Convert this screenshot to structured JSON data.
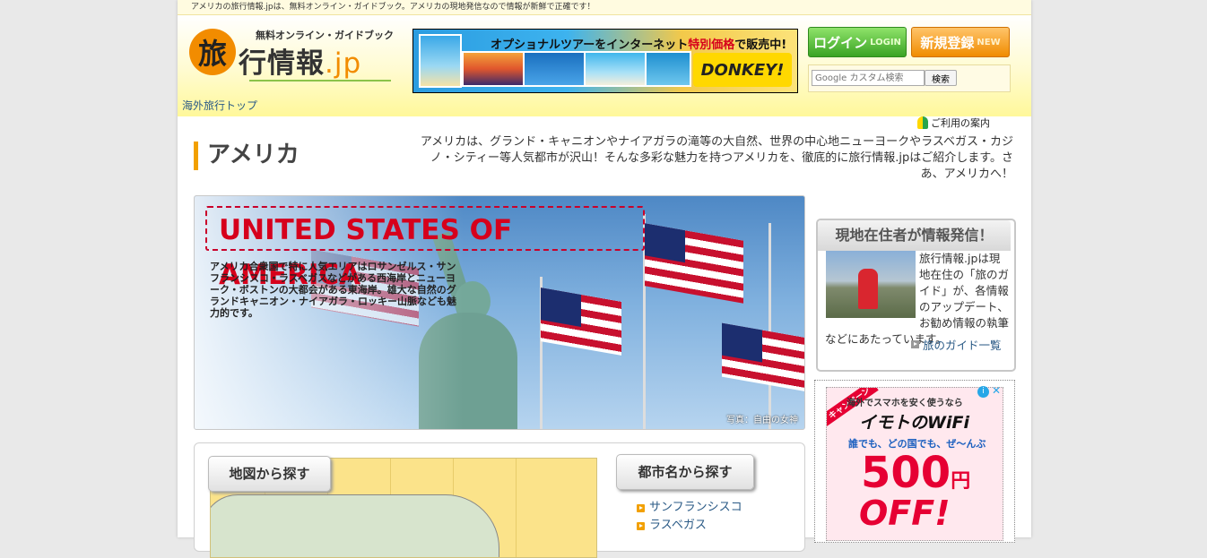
{
  "topbar": {
    "text": "アメリカの旅行情報.jpは、無料オンライン・ガイドブック。アメリカの現地発信なので情報が新鮮で正確です！"
  },
  "header": {
    "logo_small": "無料オンライン・ガイドブック",
    "logo_kanji": "旅",
    "logo_main": "行情報",
    "logo_tld": ".jp",
    "toplink": "海外旅行トップ",
    "banner": {
      "text_pre": "オプショナルツアーをインターネット",
      "text_red": "特別価格",
      "text_post": "で販売中!",
      "brand": "DONKEY!"
    },
    "login_label": "ログイン",
    "login_sub": "LOGIN",
    "register_label": "新規登録",
    "register_sub": "NEW",
    "search_placeholder": "Google カスタム検索",
    "search_button": "検索",
    "guide_link": "ご利用の案内"
  },
  "main": {
    "title": "アメリカ",
    "intro": "アメリカは、グランド・キャニオンやナイアガラの滝等の大自然、世界の中心地ニューヨークやラスベガス・カジノ・シティー等人気都市が沢山！そんな多彩な魅力を持つアメリカを、徹底的に旅行情報.jpはご紹介します。さあ、アメリカへ！",
    "hero": {
      "title": "UNITED STATES OF AMERICA",
      "desc": "アメリカ合衆国で特に人気エリアはロサンゼルス・サンフランシスコ・ラスベガスなどがある西海岸とニューヨーク・ボストンの大都会がある東海岸。雄大な自然のグランドキャニオン・ナイアガラ・ロッキー山脈なども魅力的です。",
      "caption": "写真：自由の女神"
    },
    "map_tab": "地図から探す",
    "city_tab": "都市名から探す",
    "cities": [
      "サンフランシスコ",
      "ラスベガス"
    ]
  },
  "sidebar": {
    "resident_title": "現地在住者が情報発信！",
    "resident_text": "旅行情報.jpは現地在住の「旅のガイド」が、各情報のアップデート、お勧め情報の執筆などにあたっています。",
    "resident_link": "旅のガイド一覧",
    "ad": {
      "ribbon": "キャンペーン",
      "line1": "海外でスマホを安く使うなら",
      "brand": "イモトのWiFi",
      "line2": "誰でも、どの国でも、ぜ〜んぶ",
      "amount": "500",
      "currency": "円",
      "off": "OFF!"
    }
  },
  "colors": {
    "accent_orange": "#f28c00",
    "login_green": "#3aa324",
    "hero_red": "#d6001c",
    "link_blue": "#2a5a86"
  }
}
